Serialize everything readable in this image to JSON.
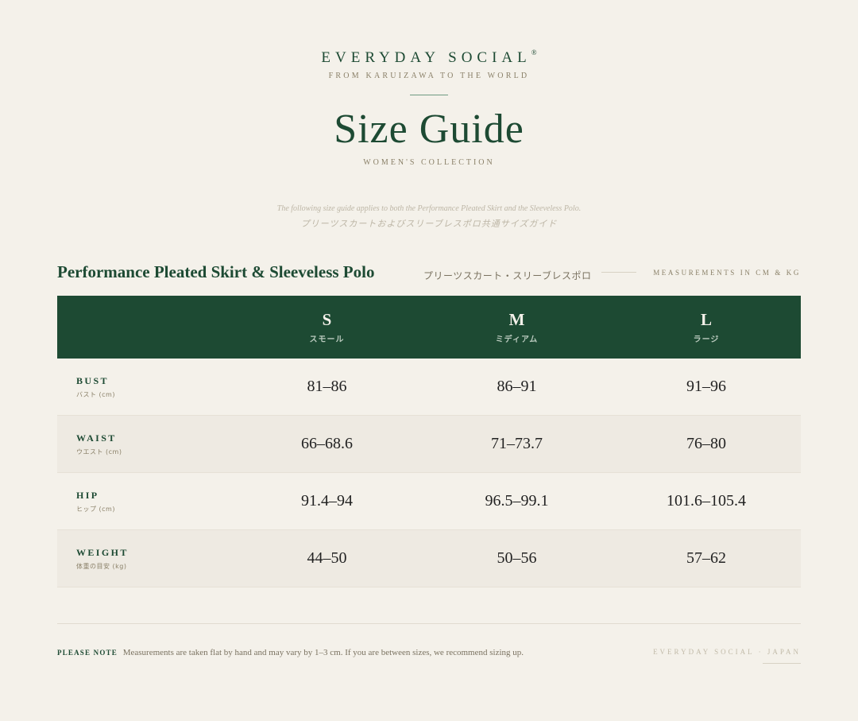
{
  "header": {
    "brand": "EVERYDAY SOCIAL",
    "registered_mark": "®",
    "tagline": "FROM KARUIZAWA TO THE WORLD",
    "title": "Size Guide",
    "collection": "WOMEN'S COLLECTION"
  },
  "intro": {
    "english": "The following size guide applies to both the Performance Pleated Skirt and the Sleeveless Polo.",
    "japanese": "プリーツスカートおよびスリーブレスポロ共通サイズガイド"
  },
  "section": {
    "title": "Performance Pleated Skirt & Sleeveless Polo",
    "title_jp": "プリーツスカート・スリーブレスポロ",
    "units": "MEASUREMENTS IN CM & KG"
  },
  "table": {
    "sizes": [
      {
        "letter": "S",
        "jp": "スモール"
      },
      {
        "letter": "M",
        "jp": "ミディアム"
      },
      {
        "letter": "L",
        "jp": "ラージ"
      }
    ],
    "rows": [
      {
        "name": "BUST",
        "jp": "バスト (cm)",
        "values": [
          "81–86",
          "86–91",
          "91–96"
        ]
      },
      {
        "name": "WAIST",
        "jp": "ウエスト (cm)",
        "values": [
          "66–68.6",
          "71–73.7",
          "76–80"
        ]
      },
      {
        "name": "HIP",
        "jp": "ヒップ (cm)",
        "values": [
          "91.4–94",
          "96.5–99.1",
          "101.6–105.4"
        ]
      },
      {
        "name": "WEIGHT",
        "jp": "体重の目安 (kg)",
        "values": [
          "44–50",
          "50–56",
          "57–62"
        ]
      }
    ]
  },
  "footer": {
    "note_label": "PLEASE NOTE",
    "note_text": "Measurements are taken flat by hand and may vary by 1–3 cm. If you are between sizes, we recommend sizing up.",
    "brand": "EVERYDAY SOCIAL · JAPAN"
  },
  "colors": {
    "accent_green": "#1d4a33",
    "background": "#f4f1ea",
    "muted_text": "#8a8068"
  }
}
